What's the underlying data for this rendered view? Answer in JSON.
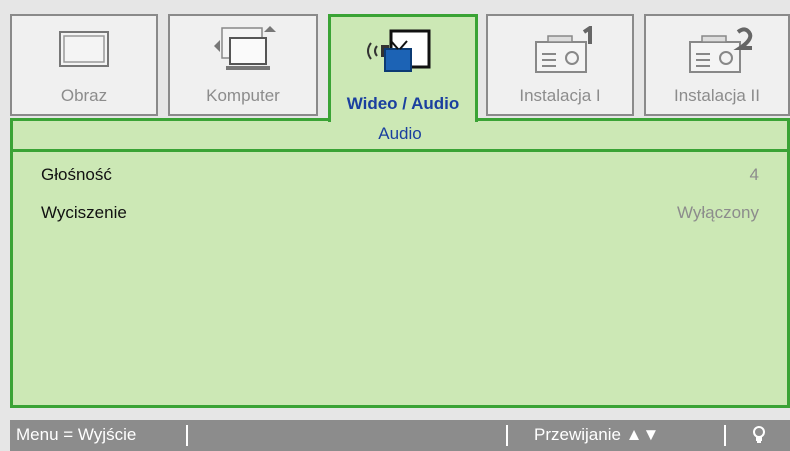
{
  "tabs": [
    {
      "label": "Obraz",
      "icon": "monitor-icon",
      "active": false
    },
    {
      "label": "Komputer",
      "icon": "computer-icon",
      "active": false
    },
    {
      "label": "Wideo / Audio",
      "icon": "video-audio-icon",
      "active": true
    },
    {
      "label": "Instalacja I",
      "icon": "projector-1-icon",
      "active": false
    },
    {
      "label": "Instalacja II",
      "icon": "projector-2-icon",
      "active": false
    }
  ],
  "section": {
    "title": "Audio"
  },
  "settings": [
    {
      "name": "Głośność",
      "value": "4"
    },
    {
      "name": "Wyciszenie",
      "value": "Wyłączony"
    }
  ],
  "status": {
    "exit_hint": "Menu = Wyjście",
    "scroll_hint": "Przewijanie",
    "scroll_arrows": "▲▼",
    "lamp_icon": "lamp-icon"
  },
  "colors": {
    "accent_green": "#3aa335",
    "panel_green": "#cce8b5",
    "active_text": "#1a3f9f",
    "muted_text": "#8c8c8c",
    "statusbar": "#8c8c8c"
  }
}
